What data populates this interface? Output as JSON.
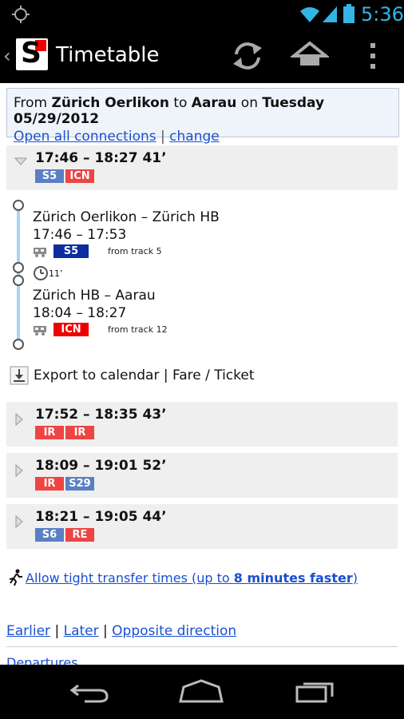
{
  "status_bar": {
    "time": "5:36",
    "icons": [
      "gps-icon",
      "wifi-icon",
      "signal-icon",
      "battery-icon"
    ],
    "accent_color": "#33b5e5"
  },
  "action_bar": {
    "logo_text": "S",
    "title": "Timetable",
    "actions": [
      "refresh-icon",
      "home-icon",
      "overflow-menu-icon"
    ]
  },
  "query": {
    "prefix": "From ",
    "from": "Zürich Oerlikon",
    "to_word": " to ",
    "to": "Aarau",
    "on_word": " on ",
    "date": "Tuesday 05/29/2012",
    "open_all": "Open all connections",
    "separator": "|",
    "change": "change"
  },
  "connections": [
    {
      "times": "17:46 – 18:27  41’",
      "badges": [
        {
          "label": "S5",
          "color": "#5a7fc4"
        },
        {
          "label": "ICN",
          "color": "#ee4444"
        }
      ],
      "expanded": true
    },
    {
      "times": "17:52 – 18:35  43’",
      "badges": [
        {
          "label": "IR",
          "color": "#ee4444"
        },
        {
          "label": "IR",
          "color": "#ee4444"
        }
      ],
      "expanded": false
    },
    {
      "times": "18:09 – 19:01  52’",
      "badges": [
        {
          "label": "IR",
          "color": "#ee4444"
        },
        {
          "label": "S29",
          "color": "#5a7fc4"
        }
      ],
      "expanded": false
    },
    {
      "times": "18:21 – 19:05  44’",
      "badges": [
        {
          "label": "S6",
          "color": "#5a7fc4"
        },
        {
          "label": "RE",
          "color": "#ee4444"
        }
      ],
      "expanded": false
    }
  ],
  "details": {
    "legs": [
      {
        "route": "Zürich Oerlikon – Zürich HB",
        "time": "17:46 – 17:53",
        "line": "S5",
        "line_color": "#0b2da0",
        "track": "from track 5"
      },
      {
        "route": "Zürich HB – Aarau",
        "time": "18:04 – 18:27",
        "line": "ICN",
        "line_color": "#e00000",
        "track": "from track 12"
      }
    ],
    "transfer": "11’"
  },
  "export": {
    "label": "Export to calendar | Fare / Ticket"
  },
  "tight_transfer": {
    "text_before": "Allow tight transfer times (up to ",
    "bold": "8 minutes faster",
    "text_after": ")"
  },
  "footer": {
    "earlier": "Earlier",
    "later": "Later",
    "opposite": "Opposite direction",
    "separator": "|",
    "departures": "Departures"
  }
}
